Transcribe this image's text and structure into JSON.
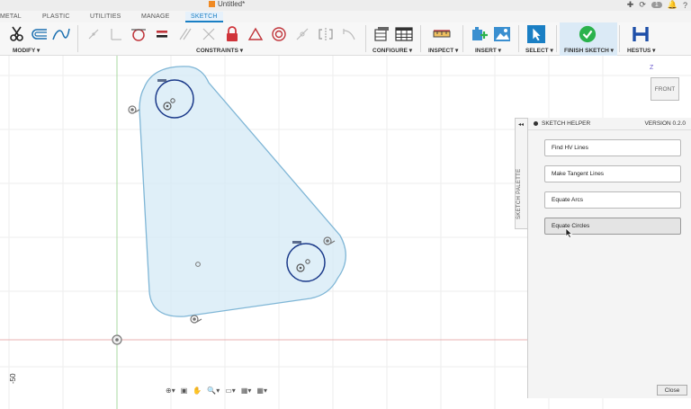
{
  "titlebar": {
    "doc_title": "Untitled*",
    "tab_count": "1"
  },
  "tabs": [
    {
      "label": "METAL"
    },
    {
      "label": "PLASTIC"
    },
    {
      "label": "UTILITIES"
    },
    {
      "label": "MANAGE"
    },
    {
      "label": "SKETCH"
    }
  ],
  "toolbar": {
    "groups": {
      "modify": "MODIFY ▾",
      "constraints": "CONSTRAINTS ▾",
      "configure": "CONFIGURE ▾",
      "inspect": "INSPECT ▾",
      "insert": "INSERT ▾",
      "select": "SELECT ▾",
      "finish_sketch": "FINISH SKETCH ▾",
      "hestus": "HESTUS ▾"
    }
  },
  "viewcube": {
    "face": "FRONT",
    "axis": "Z"
  },
  "canvas": {
    "ruler_label": "-50"
  },
  "panel": {
    "palette_tab": "SKETCH PALETTE",
    "title": "SKETCH HELPER",
    "version": "VERSION 0.2.0",
    "buttons": [
      {
        "label": "Find HV Lines"
      },
      {
        "label": "Make Tangent Lines"
      },
      {
        "label": "Equate Arcs"
      },
      {
        "label": "Equate Circles"
      }
    ],
    "close_label": "Close"
  },
  "colors": {
    "accent": "#1a7fc4",
    "sketch_fill": "#d4e9f5",
    "sketch_stroke": "#7fb6d6",
    "finish_green": "#2bb24c",
    "hestus_blue": "#1e4fa8",
    "constraint_red": "#d0343a"
  }
}
